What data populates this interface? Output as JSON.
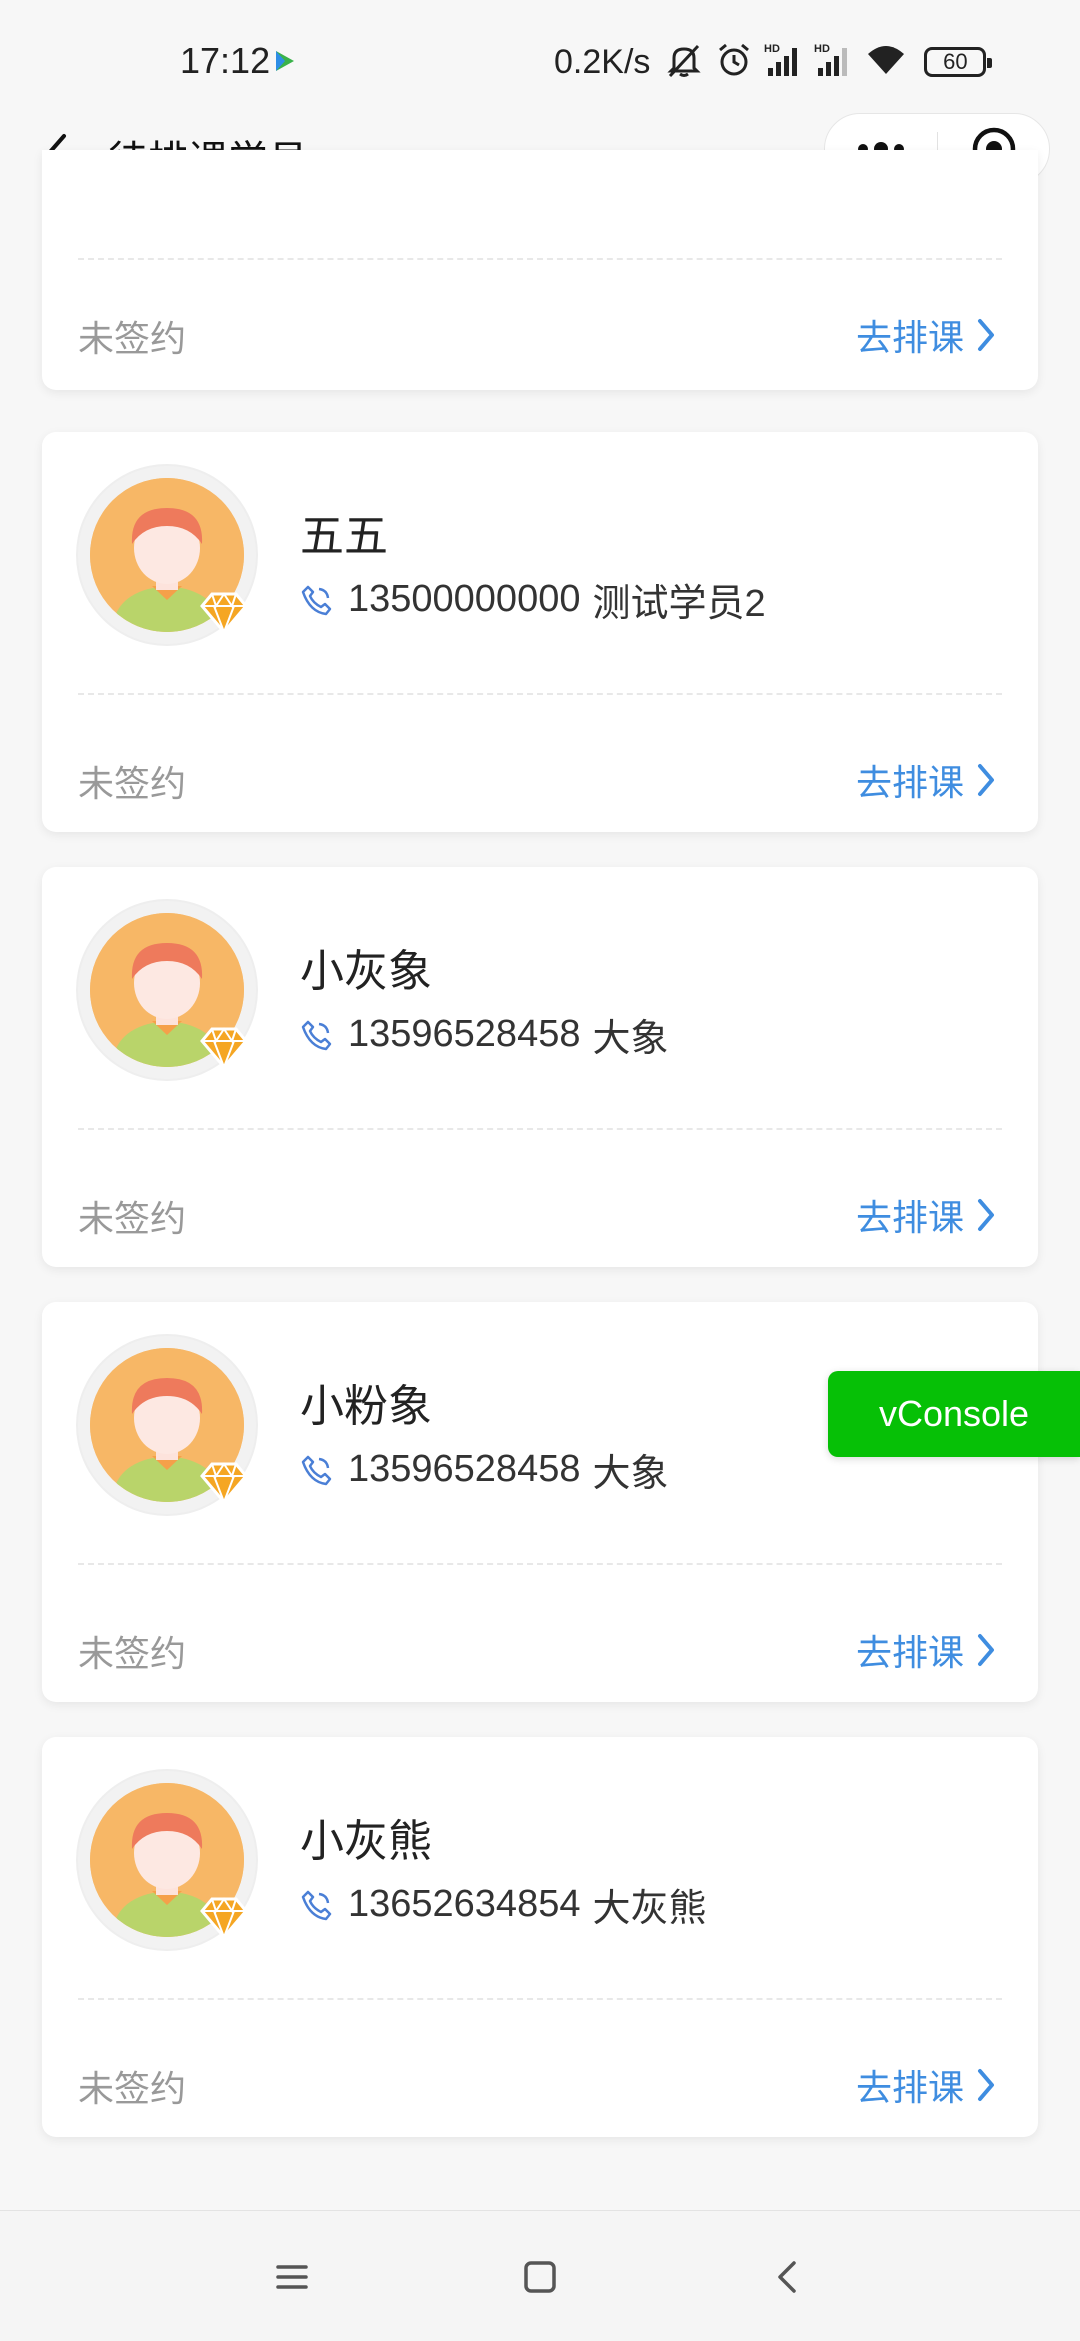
{
  "status_bar": {
    "time": "17:12",
    "network_speed": "0.2K/s",
    "battery": "60",
    "icons": [
      "play-icon",
      "mute-icon",
      "alarm-icon",
      "signal-hd-icon",
      "signal-hd-icon",
      "wifi-icon",
      "battery-icon"
    ]
  },
  "nav": {
    "title": "待排课学员",
    "back_icon": "chevron-left-icon",
    "more_icon": "more-dots-icon",
    "close_icon": "target-icon"
  },
  "students": [
    {
      "name": "",
      "phone": "",
      "note": "",
      "status": "未签约",
      "action": "去排课"
    },
    {
      "name": "五五",
      "phone": "13500000000",
      "note": "测试学员2",
      "status": "未签约",
      "action": "去排课"
    },
    {
      "name": "小灰象",
      "phone": "13596528458",
      "note": "大象",
      "status": "未签约",
      "action": "去排课"
    },
    {
      "name": "小粉象",
      "phone": "13596528458",
      "note": "大象",
      "status": "未签约",
      "action": "去排课"
    },
    {
      "name": "小灰熊",
      "phone": "13652634854",
      "note": "大灰熊",
      "status": "未签约",
      "action": "去排课"
    }
  ],
  "vconsole": {
    "label": "vConsole",
    "color": "#06c006"
  },
  "colors": {
    "accent": "#3f8de0",
    "muted": "#999999",
    "avatar_bg": "#f7b766",
    "vip_badge": "#f5a623"
  },
  "system_nav": {
    "icons": [
      "menu-icon",
      "home-icon",
      "back-icon"
    ]
  }
}
